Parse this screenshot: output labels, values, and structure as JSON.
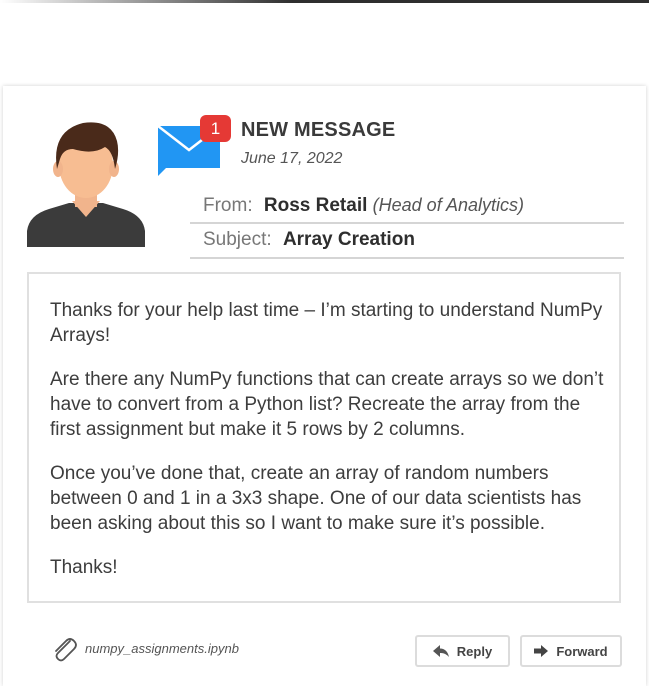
{
  "header": {
    "title": "NEW MESSAGE",
    "date": "June 17, 2022",
    "unread_count": "1",
    "icons": {
      "avatar": "user-avatar",
      "mail": "envelope-icon"
    }
  },
  "meta": {
    "from_label": "From:",
    "from_name": "Ross Retail",
    "from_role": "(Head of Analytics)",
    "subject_label": "Subject:",
    "subject_value": "Array Creation"
  },
  "message": {
    "paragraphs": [
      "Thanks for your help last time – I’m starting to understand NumPy Arrays!",
      "Are there any NumPy functions that can create arrays so we don’t have to convert from a Python list? Recreate the array from the first assignment but make it 5 rows by 2 columns.",
      "Once you’ve done that, create an array of random numbers between 0 and 1 in a 3x3 shape. One of our data scientists has been asking about this so I want to make sure it’s possible.",
      "Thanks!"
    ]
  },
  "footer": {
    "attachment_name": "numpy_assignments.ipynb",
    "reply_label": "Reply",
    "forward_label": "Forward"
  },
  "colors": {
    "badge": "#e53935",
    "envelope": "#2196f3",
    "border": "#dcdcdc"
  }
}
